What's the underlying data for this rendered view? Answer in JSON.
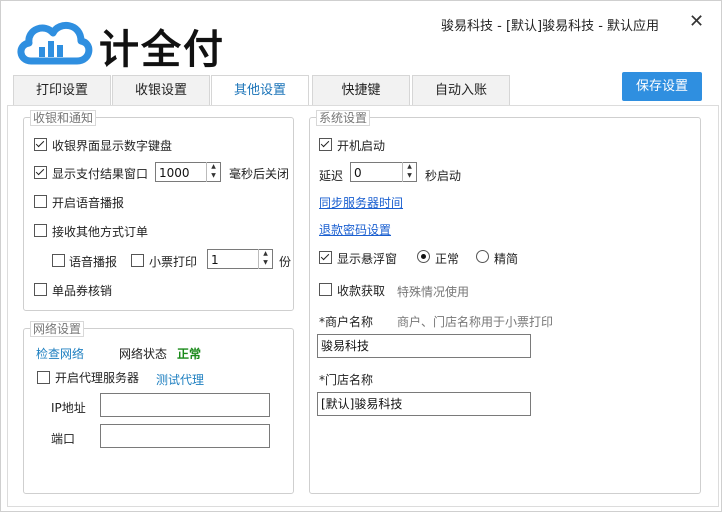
{
  "app": {
    "logo_text": "计全付",
    "title": "骏易科技 - [默认]骏易科技 - 默认应用",
    "close_icon": "close-icon"
  },
  "tabs": [
    {
      "label": "打印设置"
    },
    {
      "label": "收银设置"
    },
    {
      "label": "其他设置"
    },
    {
      "label": "快捷键"
    },
    {
      "label": "自动入账"
    }
  ],
  "active_tab": "其他设置",
  "save_label": "保存设置",
  "colors": {
    "accent": "#2f8fe0",
    "active_tab_text": "#1a73b8",
    "status_ok": "#1a8a1a",
    "link": "#1a5fd0"
  },
  "cashier_notify": {
    "legend": "收银和通知",
    "show_numpad": {
      "label": "收银界面显示数字键盘",
      "checked": true
    },
    "show_result": {
      "label": "显示支付结果窗口",
      "checked": true,
      "value": "1000",
      "suffix": "毫秒后关闭"
    },
    "voice": {
      "label": "开启语音播报",
      "checked": false
    },
    "receive_orders": {
      "label": "接收其他方式订单",
      "checked": false
    },
    "voice_broadcast": {
      "label": "语音播报",
      "checked": false
    },
    "receipt_print": {
      "label": "小票打印",
      "checked": false,
      "value": "1",
      "suffix": "份"
    },
    "coupon": {
      "label": "单品券核销",
      "checked": false
    }
  },
  "network": {
    "legend": "网络设置",
    "check_link": "检查网络",
    "status_label": "网络状态",
    "status_value": "正常",
    "proxy": {
      "label": "开启代理服务器",
      "checked": false
    },
    "test_proxy": "测试代理",
    "ip_label": "IP地址",
    "ip_value": "",
    "port_label": "端口",
    "port_value": ""
  },
  "system": {
    "legend": "系统设置",
    "autostart": {
      "label": "开机启动",
      "checked": true
    },
    "delay_label": "延迟",
    "delay_value": "0",
    "delay_suffix": "秒启动",
    "sync_time": "同步服务器时间",
    "refund_pwd": "退款密码设置",
    "float_window": {
      "label": "显示悬浮窗",
      "checked": true
    },
    "mode_normal": {
      "label": "正常",
      "checked": true
    },
    "mode_compact": {
      "label": "精简",
      "checked": false
    },
    "collect": {
      "label": "收款获取",
      "checked": false
    },
    "collect_hint": "特殊情况使用",
    "merchant_label": "*商户名称",
    "merchant_hint": "商户、门店名称用于小票打印",
    "merchant_value": "骏易科技",
    "store_label": "*门店名称",
    "store_value": "[默认]骏易科技"
  }
}
